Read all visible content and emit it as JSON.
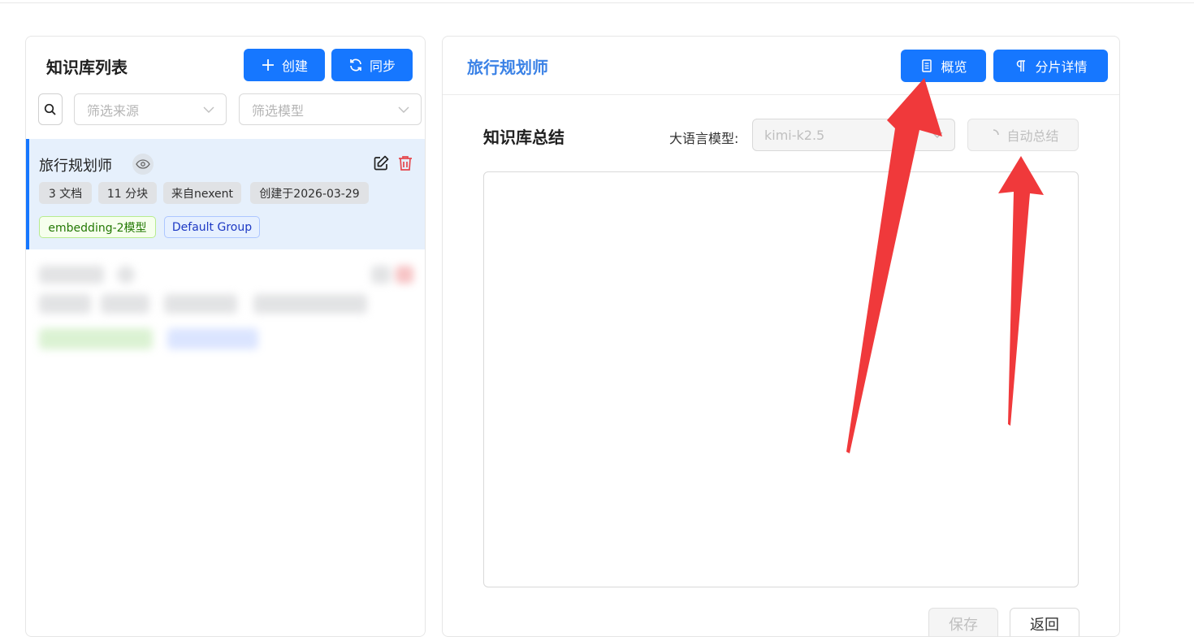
{
  "left_panel": {
    "title": "知识库列表",
    "create_label": "创建",
    "sync_label": "同步",
    "filter_source_placeholder": "筛选来源",
    "filter_model_placeholder": "筛选模型",
    "items": [
      {
        "name": "旅行规划师",
        "docs": "3 文档",
        "chunks": "11 分块",
        "source": "来自nexent",
        "created": "创建于2026-03-29",
        "model_tag": "embedding-2模型",
        "group_tag": "Default Group"
      }
    ]
  },
  "right_panel": {
    "title": "旅行规划师",
    "overview_label": "概览",
    "chunk_details_label": "分片详情",
    "summary_heading": "知识库总结",
    "llm_label": "大语言模型:",
    "llm_value": "kimi-k2.5",
    "auto_summary_label": "自动总结",
    "summary_text": "",
    "save_label": "保存",
    "back_label": "返回"
  },
  "colors": {
    "primary": "#1677ff",
    "title_blue": "#3b82e6",
    "selected_bg": "#e6f0fc",
    "arrow_red": "#f0393b"
  }
}
